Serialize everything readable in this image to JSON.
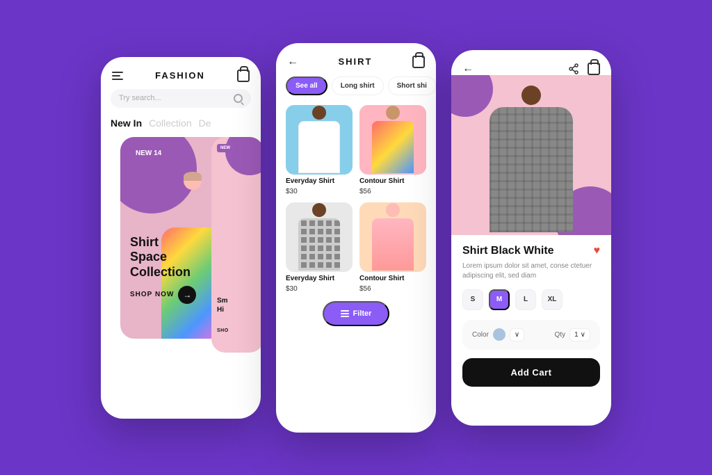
{
  "background_color": "#6B35C7",
  "phone1": {
    "header": {
      "title": "FASHION",
      "bag_icon": "bag-icon"
    },
    "search": {
      "placeholder": "Try search..."
    },
    "nav": {
      "items": [
        {
          "label": "New In",
          "active": true
        },
        {
          "label": "Collection",
          "active": false
        },
        {
          "label": "De",
          "active": false
        }
      ]
    },
    "card1": {
      "badge": "NEW 14",
      "title": "Shirt\nSpace\nCollection",
      "shop_label": "SHOP NOW"
    },
    "card2": {
      "badge": "NEW",
      "title": "Sm\nHi",
      "shop_label": "SHO"
    }
  },
  "phone2": {
    "header": {
      "title": "SHIRT"
    },
    "filters": [
      {
        "label": "See all",
        "active": true
      },
      {
        "label": "Long shirt",
        "active": false
      },
      {
        "label": "Short shi",
        "active": false
      }
    ],
    "items": [
      {
        "name": "Everyday Shirt",
        "price": "$30",
        "bg": "blue"
      },
      {
        "name": "Contour Shirt",
        "price": "$56",
        "bg": "pink"
      },
      {
        "name": "Everyday Shirt",
        "price": "$30",
        "bg": "gray"
      },
      {
        "name": "Contour Shirt",
        "price": "$56",
        "bg": "peach"
      }
    ],
    "filter_fab": {
      "label": "Filter",
      "icon": "filter-icon"
    }
  },
  "phone3": {
    "product": {
      "title": "Shirt Black White",
      "description": "Lorem ipsum dolor sit amet, conse ctetuer adipiscing elit, sed diam",
      "sizes": [
        "S",
        "M",
        "L",
        "XL"
      ],
      "active_size": "M",
      "color_label": "Color",
      "qty_label": "Qty",
      "qty_value": "1",
      "add_cart_label": "Add Cart"
    }
  }
}
